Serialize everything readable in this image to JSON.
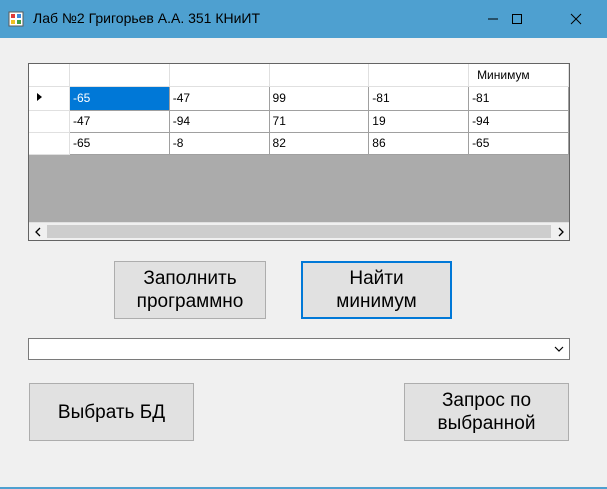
{
  "window": {
    "title": "Лаб №2 Григорьев А.А. 351 КНиИТ",
    "icon": "app-icon",
    "controls": [
      "minimize-icon",
      "maximize-icon",
      "close-icon"
    ]
  },
  "grid": {
    "columns": [
      "",
      "",
      "",
      "",
      "Минимум"
    ],
    "rows": [
      [
        "-65",
        "-47",
        "99",
        "-81",
        "-81"
      ],
      [
        "-47",
        "-94",
        "71",
        "19",
        "-94"
      ],
      [
        "-65",
        "-8",
        "82",
        "86",
        "-65"
      ]
    ],
    "current_row_marker": "▶",
    "selected_cell": "-65",
    "selection_color": "#0078d7"
  },
  "buttons": {
    "fill": "Заполнить\nпрограммно",
    "find_min": "Найти\nминимум",
    "choose_db": "Выбрать БД",
    "query": "Запрос по\nвыбранной"
  },
  "combo": {
    "value": ""
  },
  "colors": {
    "titlebar": "#4ea0d0",
    "background": "#f0f0f0"
  }
}
